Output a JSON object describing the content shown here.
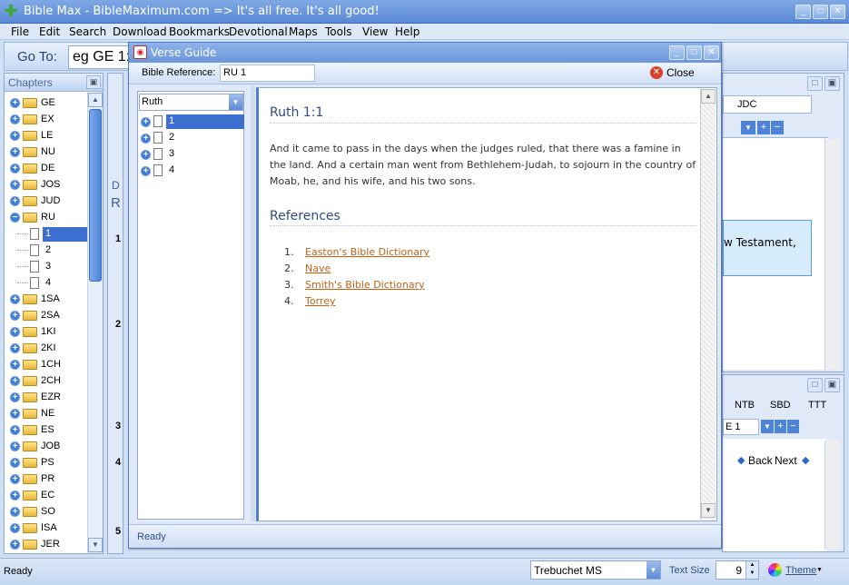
{
  "window": {
    "title": "Bible Max - BibleMaximum.com => It's all free. It's all good!",
    "min": "_",
    "max": "□",
    "close": "✕"
  },
  "menu": [
    "File",
    "Edit",
    "Search",
    "Download",
    "Bookmarks",
    "Devotional",
    "Maps",
    "Tools",
    "View",
    "Help"
  ],
  "goto": {
    "label": "Go To:",
    "value": "eg GE 1:"
  },
  "chapters": {
    "title": "Chapters",
    "pin": "ᵖ",
    "books_top": [
      "GE",
      "EX",
      "LE",
      "NU",
      "DE",
      "JOS",
      "JUD"
    ],
    "open_book": "RU",
    "open_chapters": [
      "1",
      "2",
      "3",
      "4"
    ],
    "books_bottom": [
      "1SA",
      "2SA",
      "1KI",
      "2KI",
      "1CH",
      "2CH",
      "EZR",
      "NE",
      "ES",
      "JOB",
      "PS",
      "PR",
      "EC",
      "SO",
      "ISA",
      "JER"
    ]
  },
  "background": {
    "tab_jdc": "JDC",
    "text_fragment": "w Testament,",
    "tabs_right": [
      "NTB",
      "SBD",
      "TTT"
    ],
    "ref_fragment": "E 1",
    "back": "Back",
    "next": "Next",
    "bg_letters": [
      "D",
      "R",
      "1",
      "2",
      "3",
      "4",
      "5"
    ]
  },
  "dialog": {
    "title": "Verse Guide",
    "ref_label": "Bible Reference:",
    "ref_value": "RU 1",
    "close_label": "Close",
    "book_select": "Ruth",
    "chapters": [
      "1",
      "2",
      "3",
      "4"
    ],
    "selected_chapter": "1",
    "verse_heading": "Ruth 1:1",
    "verse_text": "And it came to pass in the days when the judges ruled, that there was a famine in the land. And a certain man went from Bethlehem-Judah, to sojourn in the country of Moab, he, and his wife, and his two sons.",
    "references_heading": "References",
    "references": [
      {
        "num": "1.",
        "label": "Easton's Bible Dictionary"
      },
      {
        "num": "2.",
        "label": "Nave"
      },
      {
        "num": "3.",
        "label": "Smith's Bible Dictionary"
      },
      {
        "num": "4.",
        "label": "Torrey"
      }
    ],
    "status": "Ready"
  },
  "statusbar": {
    "left": "Ready",
    "font": "Trebuchet MS",
    "text_size_label": "Text Size",
    "text_size": "9",
    "theme": "Theme"
  }
}
